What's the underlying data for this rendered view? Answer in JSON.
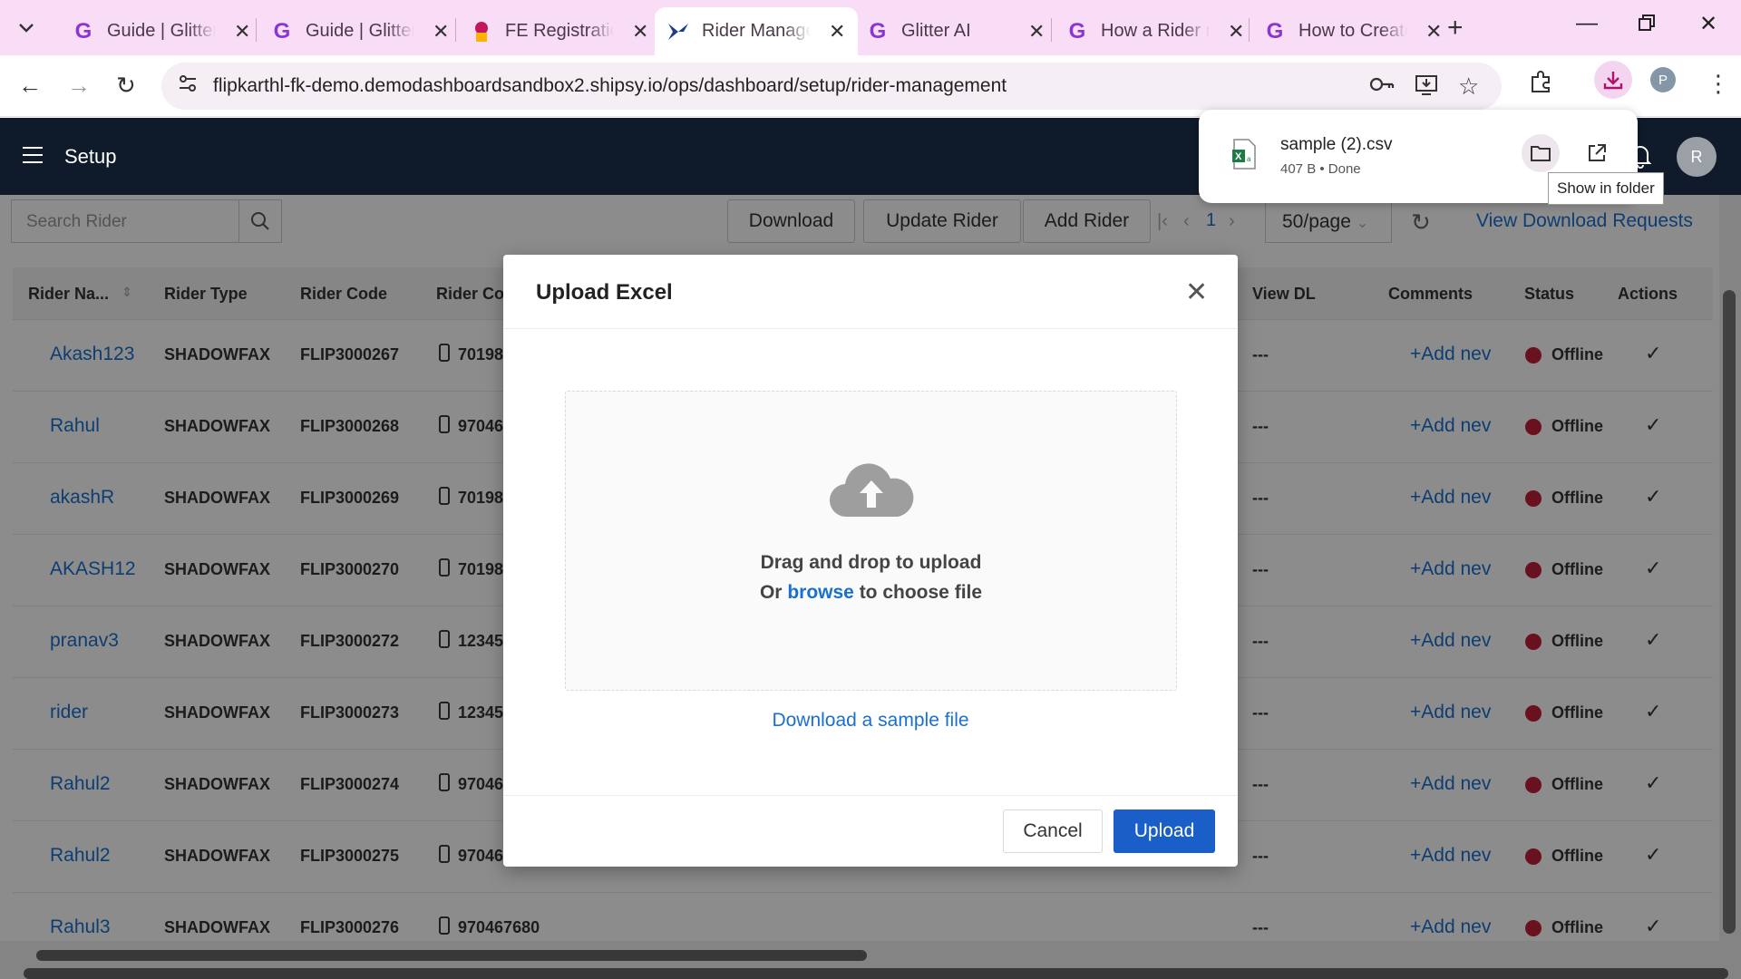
{
  "browser": {
    "tabs": [
      {
        "title": "Guide | Glitter",
        "icon": "glitter-icon",
        "active": false
      },
      {
        "title": "Guide | Glitter",
        "icon": "glitter-icon",
        "active": false
      },
      {
        "title": "FE Registration",
        "icon": "fe-icon",
        "active": false
      },
      {
        "title": "Rider Manage",
        "icon": "shipsy-icon",
        "active": true
      },
      {
        "title": "Glitter AI",
        "icon": "glitter-icon",
        "active": false
      },
      {
        "title": "How a Rider r",
        "icon": "glitter-icon",
        "active": false
      },
      {
        "title": "How to Create",
        "icon": "glitter-icon",
        "active": false
      }
    ],
    "url": "flipkarthl-fk-demo.demodashboardsandbox2.shipsy.io/ops/dashboard/setup/rider-management",
    "profile_initial": "P"
  },
  "download_bubble": {
    "filename": "sample (2).csv",
    "meta": "407 B • Done",
    "tooltip": "Show in folder"
  },
  "app": {
    "title": "Setup",
    "user_initial": "R"
  },
  "toolbar": {
    "search_placeholder": "Search Rider",
    "download_label": "Download",
    "update_label": "Update Rider",
    "add_label": "Add Rider",
    "page": "1",
    "page_size": "50/page",
    "view_download_requests": "View Download Requests"
  },
  "table": {
    "columns": {
      "name": "Rider Na...",
      "type": "Rider Type",
      "code": "Rider Code",
      "contact": "Rider Co",
      "view_dl": "View DL",
      "comments": "Comments",
      "status": "Status",
      "actions": "Actions"
    },
    "rows": [
      {
        "name": "Akash123",
        "type": "SHADOWFAX",
        "code": "FLIP3000267",
        "contact": "70198",
        "dl": "---",
        "comment": "+Add nev",
        "status": "Offline"
      },
      {
        "name": "Rahul",
        "type": "SHADOWFAX",
        "code": "FLIP3000268",
        "contact": "97046",
        "dl": "---",
        "comment": "+Add nev",
        "status": "Offline"
      },
      {
        "name": "akashR",
        "type": "SHADOWFAX",
        "code": "FLIP3000269",
        "contact": "70198",
        "dl": "---",
        "comment": "+Add nev",
        "status": "Offline"
      },
      {
        "name": "AKASH12",
        "type": "SHADOWFAX",
        "code": "FLIP3000270",
        "contact": "70198",
        "dl": "---",
        "comment": "+Add nev",
        "status": "Offline"
      },
      {
        "name": "pranav3",
        "type": "SHADOWFAX",
        "code": "FLIP3000272",
        "contact": "12345",
        "dl": "---",
        "comment": "+Add nev",
        "status": "Offline"
      },
      {
        "name": "rider",
        "type": "SHADOWFAX",
        "code": "FLIP3000273",
        "contact": "12345",
        "dl": "---",
        "comment": "+Add nev",
        "status": "Offline"
      },
      {
        "name": "Rahul2",
        "type": "SHADOWFAX",
        "code": "FLIP3000274",
        "contact": "97046",
        "dl": "---",
        "comment": "+Add nev",
        "status": "Offline"
      },
      {
        "name": "Rahul2",
        "type": "SHADOWFAX",
        "code": "FLIP3000275",
        "contact": "97046",
        "dl": "---",
        "comment": "+Add nev",
        "status": "Offline"
      },
      {
        "name": "Rahul3",
        "type": "SHADOWFAX",
        "code": "FLIP3000276",
        "contact": "970467680",
        "dl": "---",
        "comment": "+Add nev",
        "status": "Offline"
      }
    ]
  },
  "modal": {
    "title": "Upload Excel",
    "drag_text": "Drag and drop to upload",
    "or_text": "Or",
    "browse_text": "browse",
    "choose_text": "to choose file",
    "sample_link": "Download a sample file",
    "cancel_label": "Cancel",
    "upload_label": "Upload"
  },
  "colors": {
    "tabstrip": "#f9dcf5",
    "header": "#0f1a2a",
    "link": "#1a6fd0",
    "primary": "#1a5fc8",
    "status_offline": "#c0203a"
  }
}
